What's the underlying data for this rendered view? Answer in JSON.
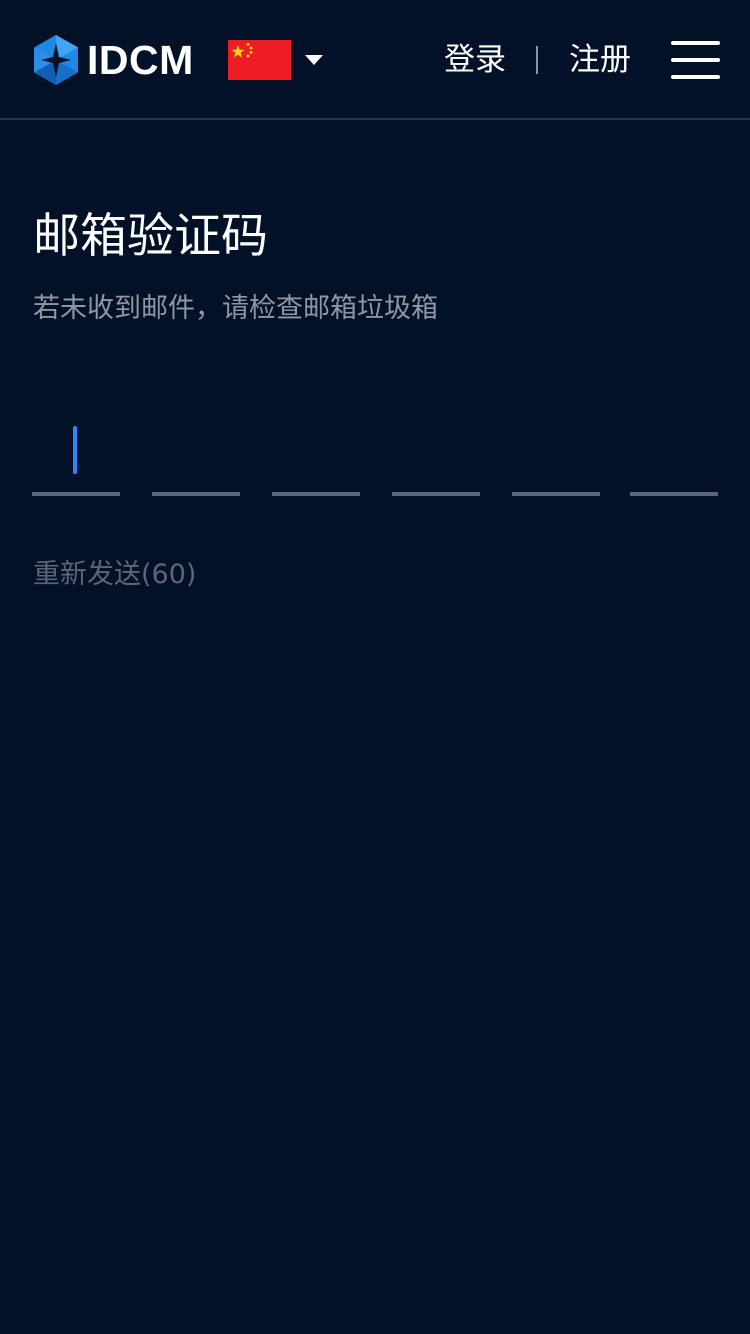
{
  "header": {
    "brand": "IDCM",
    "language_flag": "china-flag-icon",
    "login_label": "登录",
    "register_label": "注册"
  },
  "main": {
    "title": "邮箱验证码",
    "subtitle": "若未收到邮件，请检查邮箱垃圾箱",
    "code_digits": [
      "",
      "",
      "",
      "",
      "",
      ""
    ],
    "resend_label": "重新发送(60)"
  },
  "colors": {
    "background": "#021028",
    "cursor": "#2f86f6",
    "subtitle": "#8e97a6",
    "disabled_text": "#5d6677",
    "logo_blue": "#1e88e5"
  }
}
